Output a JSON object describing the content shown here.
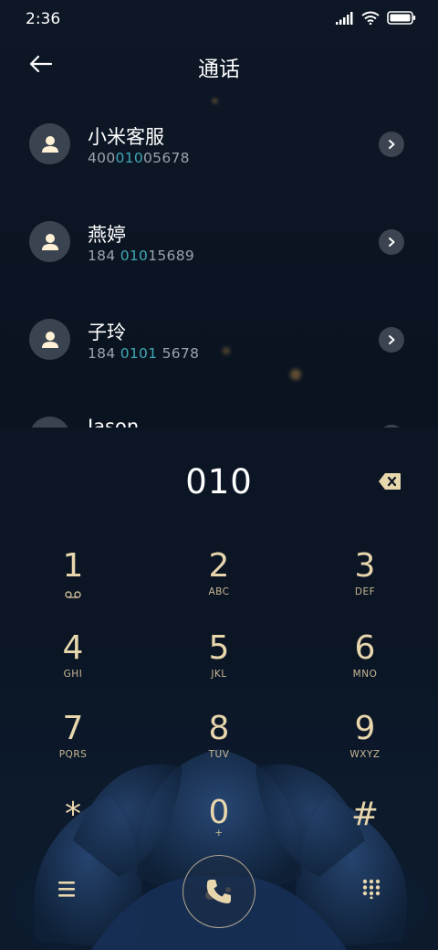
{
  "status_bar": {
    "time": "2:36"
  },
  "header": {
    "title": "通话"
  },
  "contacts": [
    {
      "name": "小米客服",
      "number_parts": [
        "400",
        "010",
        "05678"
      ]
    },
    {
      "name": "燕婷",
      "number_parts": [
        "184 ",
        "010",
        "15689"
      ]
    },
    {
      "name": "子玲",
      "number_parts": [
        "184 ",
        "0101",
        " 5678"
      ]
    },
    {
      "name": "Jason",
      "number_parts": [
        "",
        "",
        ""
      ]
    }
  ],
  "dialer": {
    "input": "010",
    "keys": [
      {
        "digit": "1",
        "letters": ""
      },
      {
        "digit": "2",
        "letters": "ABC"
      },
      {
        "digit": "3",
        "letters": "DEF"
      },
      {
        "digit": "4",
        "letters": "GHI"
      },
      {
        "digit": "5",
        "letters": "JKL"
      },
      {
        "digit": "6",
        "letters": "MNO"
      },
      {
        "digit": "7",
        "letters": "PQRS"
      },
      {
        "digit": "8",
        "letters": "TUV"
      },
      {
        "digit": "9",
        "letters": "WXYZ"
      },
      {
        "digit": "*",
        "letters": ""
      },
      {
        "digit": "0",
        "letters": "+"
      },
      {
        "digit": "#",
        "letters": ""
      }
    ]
  },
  "icons": {
    "status": [
      "signal-icon",
      "wifi-icon",
      "battery-icon"
    ],
    "back": "back-arrow-icon",
    "backspace": "backspace-icon",
    "voicemail": "voicemail-icon",
    "menu": "menu-icon",
    "call": "phone-icon",
    "dialpad": "dialpad-icon"
  },
  "colors": {
    "accent_number_highlight": "#41a9b6",
    "key_gold": "#e8d6ad",
    "background": "#0b1422"
  }
}
